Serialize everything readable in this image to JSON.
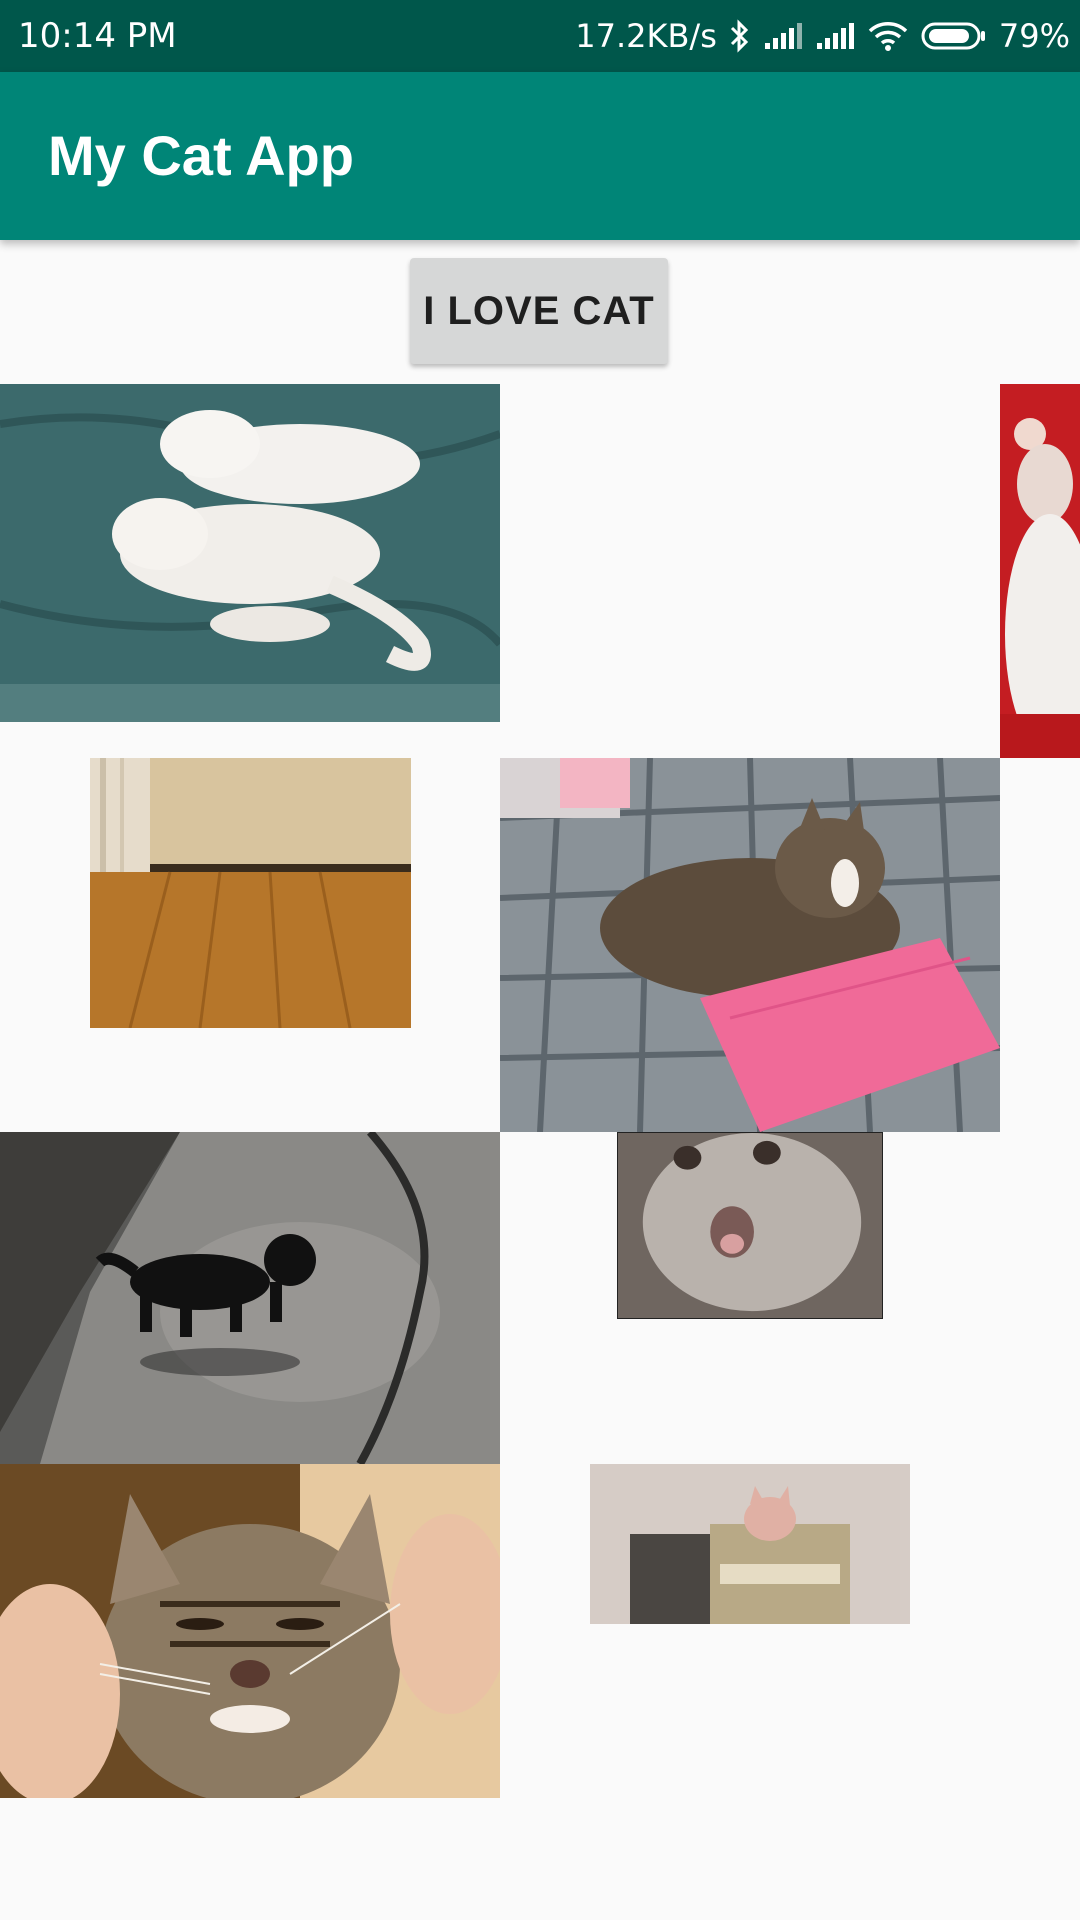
{
  "status_bar": {
    "time": "10:14  PM",
    "network_speed": "17.2KB/s",
    "battery_percent": "79%",
    "icons": [
      "bluetooth-icon",
      "signal-icon",
      "signal-icon",
      "wifi-icon",
      "battery-icon"
    ]
  },
  "app_bar": {
    "title": "My Cat App"
  },
  "main": {
    "button_label": "I LOVE CAT",
    "images": [
      "two-white-cats-image",
      "cat-with-red-toy-image",
      "wood-floor-room-image",
      "tabby-cat-on-blanket-image",
      "black-kitten-alley-image",
      "surprised-cat-image",
      "kitten-whiskers-image",
      "cat-in-box-image"
    ]
  },
  "colors": {
    "status_bar": "#00574b",
    "app_bar": "#008577",
    "background": "#fafafa",
    "button": "#d6d7d7"
  }
}
